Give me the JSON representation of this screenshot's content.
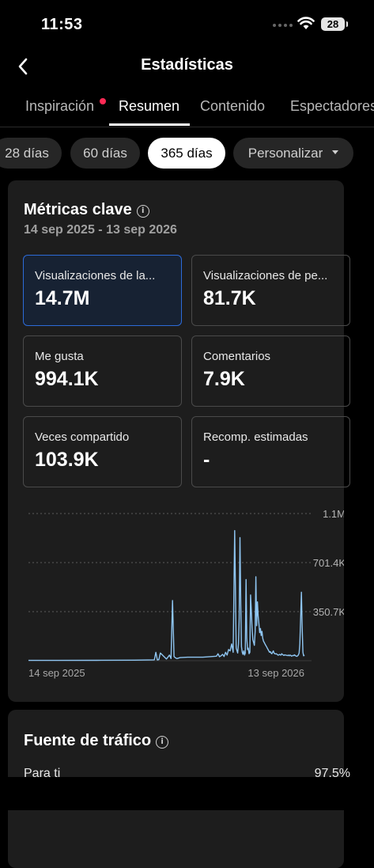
{
  "status_bar": {
    "time": "11:53",
    "battery": "28"
  },
  "header": {
    "title": "Estadísticas"
  },
  "tabs": [
    {
      "label": "Inspiración",
      "has_dot": true
    },
    {
      "label": "Resumen",
      "active": true
    },
    {
      "label": "Contenido"
    },
    {
      "label": "Espectadores"
    }
  ],
  "date_filters": [
    {
      "label": "28 días"
    },
    {
      "label": "60 días"
    },
    {
      "label": "365 días",
      "active": true
    },
    {
      "label": "Personalizar"
    }
  ],
  "key_metrics": {
    "title": "Métricas clave",
    "date_range": "14 sep 2025 - 13 sep 2026",
    "tiles": [
      {
        "label": "Visualizaciones de la...",
        "value": "14.7M",
        "selected": true
      },
      {
        "label": "Visualizaciones de pe...",
        "value": "81.7K"
      },
      {
        "label": "Me gusta",
        "value": "994.1K"
      },
      {
        "label": "Comentarios",
        "value": "7.9K"
      },
      {
        "label": "Veces compartido",
        "value": "103.9K"
      },
      {
        "label": "Recomp. estimadas",
        "value": "-"
      }
    ]
  },
  "chart_data": {
    "type": "line",
    "y_tick_labels": [
      "1.1M",
      "701.4K",
      "350.7K"
    ],
    "y_ticks": [
      1052100,
      701400,
      350700
    ],
    "ylim": [
      0,
      1052100
    ],
    "x_tick_labels": [
      "14 sep 2025",
      "13 sep 2026"
    ],
    "series_color": "#8fc6f2",
    "x": [
      0,
      40,
      90,
      140,
      166,
      168,
      170,
      172,
      174,
      182,
      186,
      188,
      190,
      192,
      194,
      196,
      200,
      210,
      230,
      248,
      250,
      252,
      254,
      256,
      258,
      260,
      262,
      264,
      266,
      268,
      270,
      272,
      274,
      276,
      277,
      278,
      279,
      280,
      281,
      282,
      283,
      284,
      285,
      286,
      287,
      288,
      289,
      290,
      291,
      292,
      293,
      294,
      295,
      296,
      297,
      298,
      299,
      300,
      301,
      302,
      303,
      304,
      305,
      306,
      307,
      308,
      309,
      310,
      311,
      312,
      313,
      314,
      315,
      316,
      317,
      318,
      319,
      320,
      321,
      322,
      323,
      324,
      325,
      326,
      327,
      328,
      329,
      330,
      331,
      332,
      333,
      334,
      335,
      336,
      337,
      338,
      339,
      340,
      341,
      342,
      343,
      344,
      345,
      346,
      347,
      348,
      349,
      350,
      351,
      352,
      353,
      354,
      355,
      356,
      357,
      358,
      359,
      360,
      361,
      362,
      363,
      364
    ],
    "y": [
      2000,
      2000,
      3000,
      4000,
      6000,
      60000,
      5000,
      8000,
      55000,
      12000,
      40000,
      15000,
      430000,
      30000,
      20000,
      15000,
      22000,
      25000,
      25000,
      32000,
      50000,
      28000,
      35000,
      45000,
      30000,
      60000,
      40000,
      80000,
      70000,
      120000,
      60000,
      930000,
      90000,
      55000,
      120000,
      300000,
      880000,
      400000,
      100000,
      60000,
      45000,
      70000,
      40000,
      55000,
      580000,
      160000,
      80000,
      90000,
      50000,
      60000,
      470000,
      350000,
      230000,
      150000,
      130000,
      110000,
      210000,
      600000,
      250000,
      420000,
      320000,
      260000,
      200000,
      230000,
      180000,
      210000,
      160000,
      140000,
      130000,
      120000,
      110000,
      100000,
      90000,
      80000,
      70000,
      60000,
      65000,
      55000,
      50000,
      60000,
      70000,
      55000,
      50000,
      48000,
      50000,
      45000,
      40000,
      40000,
      45000,
      42000,
      40000,
      50000,
      45000,
      40000,
      38000,
      42000,
      40000,
      39000,
      38000,
      36000,
      40000,
      35000,
      40000,
      38000,
      33000,
      35000,
      38000,
      36000,
      42000,
      36000,
      33000,
      31000,
      35000,
      40000,
      55000,
      120000,
      300000,
      490000,
      250000,
      60000,
      35000,
      40000
    ]
  },
  "traffic": {
    "title": "Fuente de tráfico",
    "rows": [
      {
        "label": "Para ti",
        "value": "97.5%"
      }
    ]
  }
}
